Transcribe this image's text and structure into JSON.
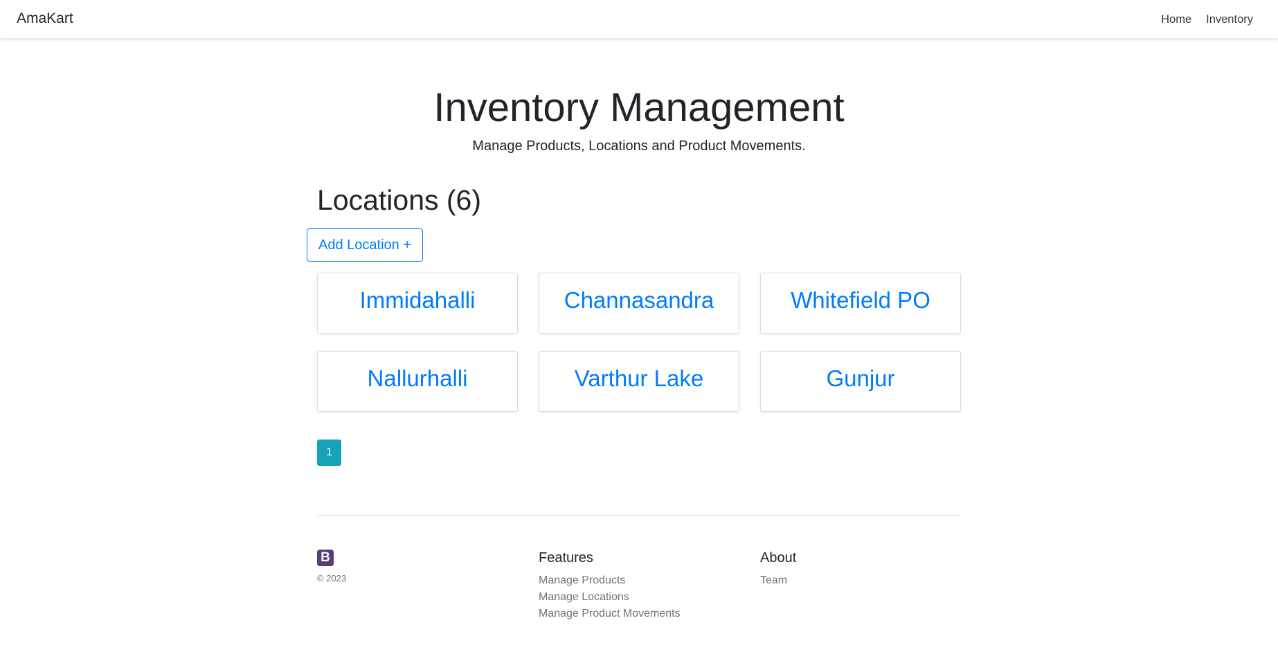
{
  "navbar": {
    "brand": "AmaKart",
    "links": [
      "Home",
      "Inventory"
    ]
  },
  "hero": {
    "title": "Inventory Management",
    "subtitle": "Manage Products, Locations and Product Movements."
  },
  "locations": {
    "heading": "Locations (6)",
    "add_button": "Add Location +",
    "items": [
      "Immidahalli",
      "Channasandra",
      "Whitefield PO",
      "Nallurhalli",
      "Varthur Lake",
      "Gunjur"
    ]
  },
  "pagination": {
    "current_page": "1"
  },
  "footer": {
    "logo_letter": "B",
    "copyright": "© 2023",
    "features": {
      "heading": "Features",
      "links": [
        "Manage Products",
        "Manage Locations",
        "Manage Product Movements"
      ]
    },
    "about": {
      "heading": "About",
      "links": [
        "Team"
      ]
    }
  },
  "colors": {
    "accent": "#007bff",
    "pagination_active": "#17a2b8",
    "logo_bg": "#563d7c",
    "muted_text": "#6c757d"
  }
}
